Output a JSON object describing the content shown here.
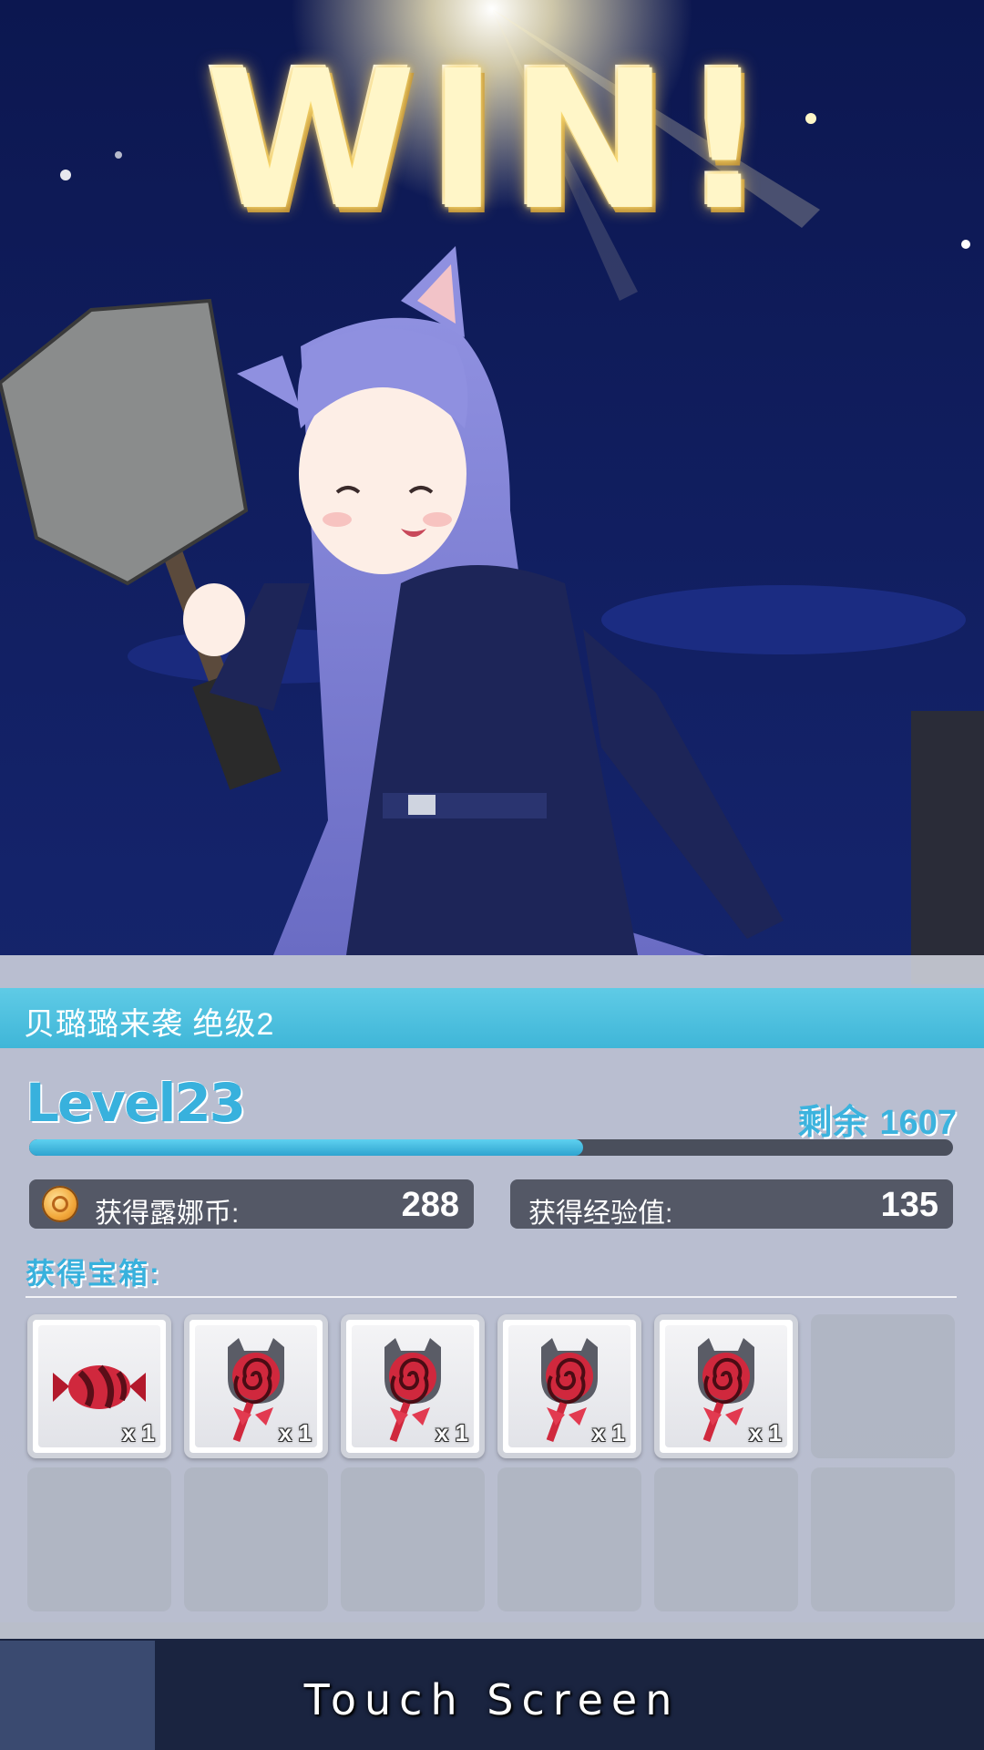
{
  "banner": {
    "title": "WIN!"
  },
  "result": {
    "stage_name": "贝璐璐来袭  绝级2",
    "level_label": "Level23",
    "remaining_label": "剩余",
    "remaining_value": "1607",
    "exp_progress_fraction": 0.6,
    "coins_label": "获得露娜币:",
    "coins_value": "288",
    "exp_label": "获得经验值:",
    "exp_value": "135",
    "chest_label": "获得宝箱:"
  },
  "rewards": [
    {
      "item": "candy-icon",
      "qty": "x 1"
    },
    {
      "item": "lollipop-icon",
      "qty": "x 1"
    },
    {
      "item": "lollipop-icon",
      "qty": "x 1"
    },
    {
      "item": "lollipop-icon",
      "qty": "x 1"
    },
    {
      "item": "lollipop-icon",
      "qty": "x 1"
    }
  ],
  "empty_slots": 7,
  "footer": {
    "prompt": "Touch Screen"
  },
  "colors": {
    "accent_blue": "#38b1dd",
    "bar_blue": "#5fcbe6",
    "stat_box": "#464a56",
    "night_sky": "#0d1a4d",
    "item_red": "#d0283d"
  }
}
